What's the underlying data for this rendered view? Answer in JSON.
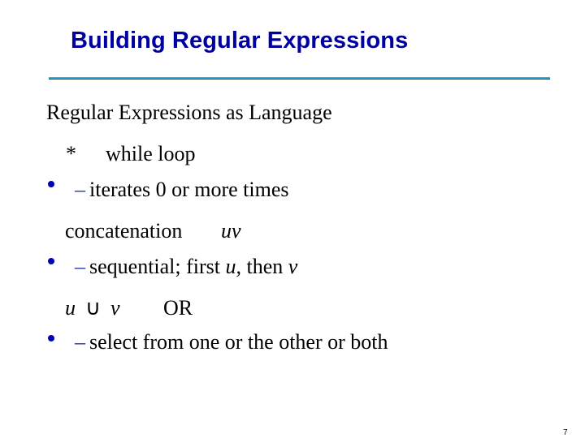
{
  "slide": {
    "title": "Building Regular Expressions",
    "subtitle": "Regular Expressions as Language",
    "bullets": [
      {
        "main_parts": {
          "symbol": "*",
          "label": "while loop"
        },
        "sub": "iterates 0 or more times"
      },
      {
        "main_parts": {
          "label": "concatenation",
          "expression": "uv"
        },
        "sub_parts": {
          "text_before": "sequential; first ",
          "var1": "u,",
          "text_middle": " then ",
          "var2": "v"
        }
      },
      {
        "main_parts": {
          "var1": "u",
          "operator": "∪",
          "var2": "v",
          "label": "OR"
        },
        "sub": "select from one or the other or both"
      }
    ],
    "sub_bullet_marker": "–",
    "page_number": "7",
    "colors": {
      "title": "#0000a0",
      "bullet": "#0000b4",
      "rule_light": "#33b5e0",
      "rule_dark": "#0a2f6b",
      "body_text": "#000000"
    }
  }
}
